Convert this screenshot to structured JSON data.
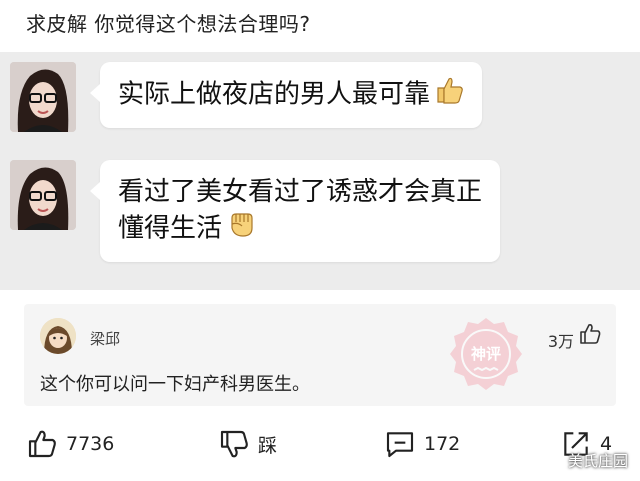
{
  "title": "求皮解 你觉得这个想法合理吗?",
  "chat": {
    "messages": [
      {
        "text": "实际上做夜店的男人最可靠",
        "emoji": "thumbs-up-icon"
      },
      {
        "line1": "看过了美女看过了诱惑才会真正",
        "line2": "懂得生活",
        "emoji": "fist-icon"
      }
    ]
  },
  "comment": {
    "username": "梁邱",
    "text": "这个你可以问一下妇产科男医生。",
    "likes": "3万",
    "stamp": "神评"
  },
  "actions": {
    "like_count": "7736",
    "dislike_label": "踩",
    "comment_count": "172",
    "share_count": "4"
  },
  "watermark": "美氏庄园"
}
